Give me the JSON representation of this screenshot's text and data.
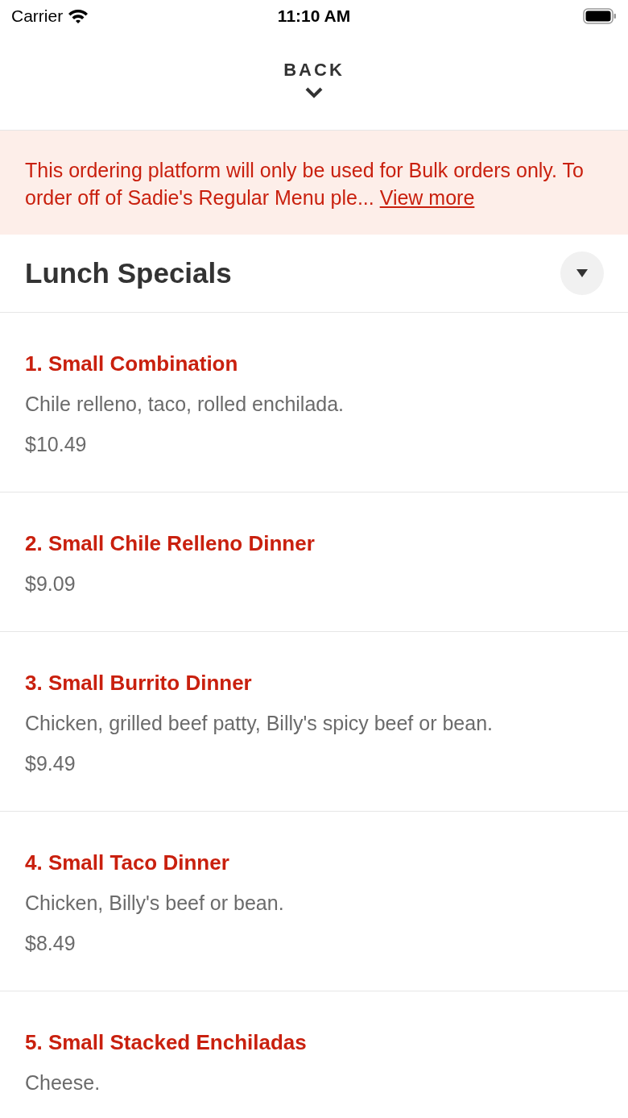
{
  "status_bar": {
    "carrier": "Carrier",
    "time": "11:10 AM"
  },
  "header": {
    "back_label": "BACK"
  },
  "notice": {
    "text": "This ordering platform will only be used for Bulk orders only. To order off of Sadie's Regular Menu ple...",
    "link": "View more"
  },
  "section": {
    "title": "Lunch Specials",
    "expanded": true
  },
  "items": [
    {
      "name": "1. Small Combination",
      "description": "Chile relleno, taco, rolled enchilada.",
      "price": "$10.49"
    },
    {
      "name": "2. Small Chile Relleno Dinner",
      "price": "$9.09"
    },
    {
      "name": "3. Small Burrito Dinner",
      "description": "Chicken, grilled beef patty, Billy's spicy beef or bean.",
      "price": "$9.49"
    },
    {
      "name": "4. Small Taco Dinner",
      "description": "Chicken, Billy's beef or bean.",
      "price": "$8.49"
    },
    {
      "name": "5. Small Stacked Enchiladas",
      "description": "Cheese."
    }
  ]
}
